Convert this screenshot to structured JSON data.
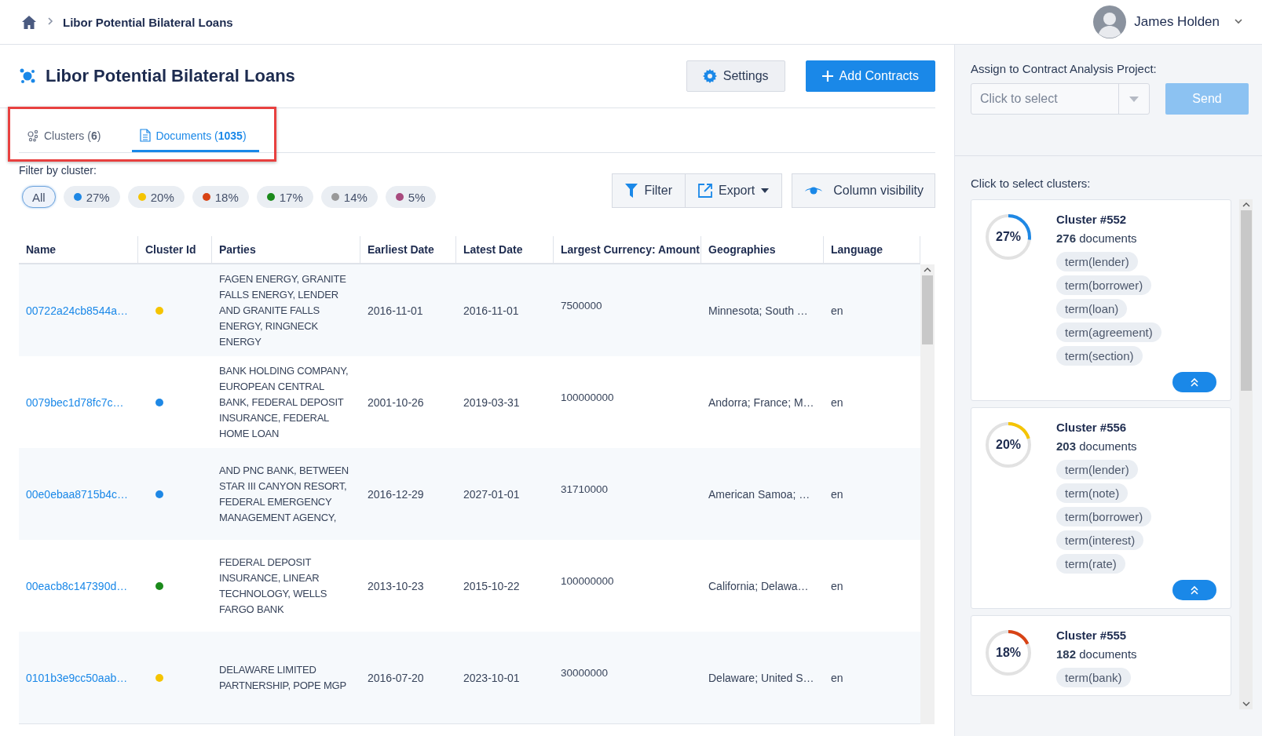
{
  "breadcrumb": {
    "current": "Libor Potential Bilateral Loans"
  },
  "user": {
    "name": "James Holden"
  },
  "page": {
    "title": "Libor Potential Bilateral Loans"
  },
  "buttons": {
    "settings": "Settings",
    "add": "Add Contracts"
  },
  "tabs": [
    {
      "label": "Clusters (**6**)",
      "selected": false,
      "kind": "clusters"
    },
    {
      "label": "Documents (**1035**)",
      "selected": true,
      "kind": "documents"
    }
  ],
  "filter": {
    "label": "Filter by cluster:",
    "chips": [
      {
        "label": "All",
        "selected": true
      },
      {
        "label": "27%",
        "selected": false,
        "color": "#1e88e5"
      },
      {
        "label": "20%",
        "selected": false,
        "color": "#f5c400"
      },
      {
        "label": "18%",
        "selected": false,
        "color": "#d84315"
      },
      {
        "label": "17%",
        "selected": false,
        "color": "#1b8a1b"
      },
      {
        "label": "14%",
        "selected": false,
        "color": "#999999"
      },
      {
        "label": "5%",
        "selected": false,
        "color": "#a84a7e"
      }
    ]
  },
  "toolbar": {
    "filter": "Filter",
    "export": "Export",
    "columns": "Column visibility"
  },
  "table": {
    "columns": [
      "Name",
      "Cluster Id",
      "Parties",
      "Earliest Date",
      "Latest Date",
      "Largest Currency: Amount",
      "Geographies",
      "Language"
    ],
    "rows": [
      {
        "name": "00722a24cb8544a…",
        "color": "#f5c400",
        "parties": "FAGEN ENERGY, GRANITE FALLS ENERGY, LENDER AND GRANITE FALLS ENERGY, RINGNECK ENERGY",
        "earliest": "2016-11-01",
        "latest": "2016-11-01",
        "amount": "7500000",
        "geographies": "Minnesota; South …",
        "language": "en"
      },
      {
        "name": "0079bec1d78fc7c…",
        "color": "#1e88e5",
        "parties": "BANK HOLDING COMPANY, EUROPEAN CENTRAL BANK, FEDERAL DEPOSIT INSURANCE, FEDERAL HOME LOAN",
        "earliest": "2001-10-26",
        "latest": "2019-03-31",
        "amount": "100000000",
        "geographies": "Andorra; France; M…",
        "language": "en"
      },
      {
        "name": "00e0ebaa8715b4c…",
        "color": "#1e88e5",
        "parties": "AND PNC BANK, BETWEEN STAR III CANYON RESORT, FEDERAL EMERGENCY MANAGEMENT AGENCY,",
        "earliest": "2016-12-29",
        "latest": "2027-01-01",
        "amount": "31710000",
        "geographies": "American Samoa; …",
        "language": "en"
      },
      {
        "name": "00eacb8c147390d…",
        "color": "#1b8a1b",
        "parties": "FEDERAL DEPOSIT INSURANCE, LINEAR TECHNOLOGY, WELLS FARGO BANK",
        "earliest": "2013-10-23",
        "latest": "2015-10-22",
        "amount": "100000000",
        "geographies": "California; Delawa…",
        "language": "en"
      },
      {
        "name": "0101b3e9cc50aab…",
        "color": "#f5c400",
        "parties": "DELAWARE LIMITED PARTNERSHIP, POPE MGP",
        "earliest": "2016-07-20",
        "latest": "2023-10-01",
        "amount": "30000000",
        "geographies": "Delaware; United S…",
        "language": "en"
      }
    ]
  },
  "side": {
    "assign_label": "Assign to Contract Analysis Project:",
    "select": {
      "placeholder": "Click to select"
    },
    "send": {
      "label": "Send",
      "disabled": true
    },
    "clusters_label": "Click to select clusters:",
    "clusters": [
      {
        "percent": "27%",
        "level": 0.27,
        "color": "#1e88e5",
        "title": "Cluster #552",
        "documents": "**276** documents",
        "terms": [
          "term(lender)",
          "term(borrower)",
          "term(loan)",
          "term(agreement)",
          "term(section)"
        ]
      },
      {
        "percent": "20%",
        "level": 0.2,
        "color": "#f5c400",
        "title": "Cluster #556",
        "documents": "**203** documents",
        "terms": [
          "term(lender)",
          "term(note)",
          "term(borrower)",
          "term(interest)",
          "term(rate)"
        ]
      },
      {
        "percent": "18%",
        "level": 0.18,
        "color": "#d84315",
        "title": "Cluster #555",
        "documents": "**182** documents",
        "terms": [
          "term(bank)"
        ]
      }
    ]
  }
}
